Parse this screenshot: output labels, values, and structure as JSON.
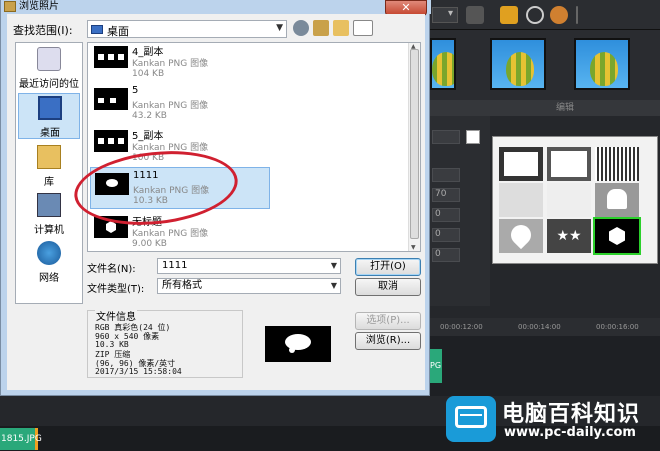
{
  "dialog": {
    "title": "浏览照片",
    "close_label": "✕",
    "look_in_label": "查找范围(I):",
    "look_in_value": "桌面",
    "places": [
      {
        "label": "最近访问的位置",
        "icon": "recent-places-icon"
      },
      {
        "label": "桌面",
        "icon": "desktop-icon"
      },
      {
        "label": "库",
        "icon": "libraries-icon"
      },
      {
        "label": "计算机",
        "icon": "computer-icon"
      },
      {
        "label": "网络",
        "icon": "network-icon"
      }
    ],
    "files": [
      {
        "name": "4_副本",
        "type": "Kankan PNG 图像",
        "size": "104 KB"
      },
      {
        "name": "5",
        "type": "Kankan PNG 图像",
        "size": "43.2 KB"
      },
      {
        "name": "5_副本",
        "type": "Kankan PNG 图像",
        "size": "100 KB"
      },
      {
        "name": "1111",
        "type": "Kankan PNG 图像",
        "size": "10.3 KB"
      },
      {
        "name": "无标题",
        "type": "Kankan PNG 图像",
        "size": "9.00 KB"
      }
    ],
    "file_name_label": "文件名(N):",
    "file_name_value": "1111",
    "file_type_label": "文件类型(T):",
    "file_type_value": "所有格式",
    "open_button": "打开(O)",
    "cancel_button": "取消",
    "options_button": "选项(P)...",
    "browse_button": "浏览(R)...",
    "info_title": "文件信息",
    "info_lines": [
      "RGB 真彩色(24 位)",
      "960 x 540 像素",
      "10.3 KB",
      "ZIP 压缩",
      "(96, 96) 像素/英寸",
      "2017/3/15  15:58:04"
    ]
  },
  "editor": {
    "edit_bar_label": "编辑",
    "prop_values": [
      "",
      "",
      "70",
      "0",
      "0",
      "0"
    ],
    "timeline_ticks": [
      "00:00:12:00",
      "00:00:14:00",
      "00:00:16:00"
    ],
    "clip_right": "PG",
    "bottom_clip": "1815.JPG"
  },
  "watermark": {
    "title": "电脑百科知识",
    "url": "www.pc-daily.com"
  },
  "colors": {
    "selection": "#cce4f7",
    "annotation_red": "#d02030",
    "mask_selected": "#2bd02b",
    "watermark_blue": "#1a9bd8"
  }
}
